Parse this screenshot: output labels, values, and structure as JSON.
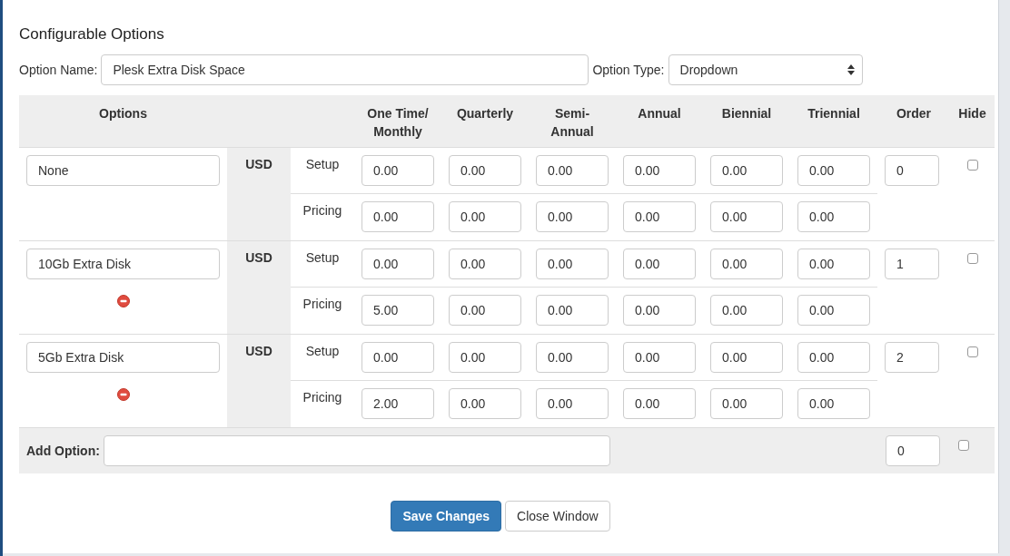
{
  "title": "Configurable Options",
  "option_name": {
    "label": "Option Name:",
    "value": "Plesk Extra Disk Space"
  },
  "option_type": {
    "label": "Option Type:",
    "value": "Dropdown"
  },
  "columns": [
    "Options",
    "One Time/\nMonthly",
    "Quarterly",
    "Semi-\nAnnual",
    "Annual",
    "Biennial",
    "Triennial",
    "Order",
    "Hide"
  ],
  "options": [
    {
      "name": "None",
      "removable": false,
      "currency": "USD",
      "setup": {
        "label": "Setup",
        "values": [
          "0.00",
          "0.00",
          "0.00",
          "0.00",
          "0.00",
          "0.00"
        ]
      },
      "pricing": {
        "label": "Pricing",
        "values": [
          "0.00",
          "0.00",
          "0.00",
          "0.00",
          "0.00",
          "0.00"
        ]
      },
      "order": "0",
      "hidden": false
    },
    {
      "name": "10Gb Extra Disk",
      "removable": true,
      "currency": "USD",
      "setup": {
        "label": "Setup",
        "values": [
          "0.00",
          "0.00",
          "0.00",
          "0.00",
          "0.00",
          "0.00"
        ]
      },
      "pricing": {
        "label": "Pricing",
        "values": [
          "5.00",
          "0.00",
          "0.00",
          "0.00",
          "0.00",
          "0.00"
        ]
      },
      "order": "1",
      "hidden": false
    },
    {
      "name": "5Gb Extra Disk",
      "removable": true,
      "currency": "USD",
      "setup": {
        "label": "Setup",
        "values": [
          "0.00",
          "0.00",
          "0.00",
          "0.00",
          "0.00",
          "0.00"
        ]
      },
      "pricing": {
        "label": "Pricing",
        "values": [
          "2.00",
          "0.00",
          "0.00",
          "0.00",
          "0.00",
          "0.00"
        ]
      },
      "order": "2",
      "hidden": false
    }
  ],
  "add_option": {
    "label": "Add Option:",
    "order": "0",
    "hidden": false
  },
  "buttons": [
    {
      "label": "Save Changes",
      "kind": "primary"
    },
    {
      "label": "Close Window",
      "kind": "default"
    }
  ]
}
